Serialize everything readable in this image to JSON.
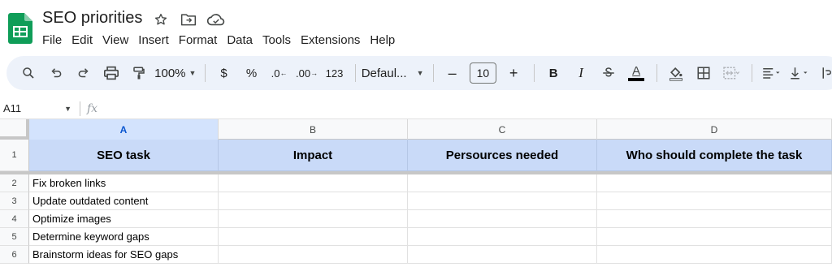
{
  "document": {
    "title": "SEO priorities"
  },
  "icons": {
    "logo": "google-sheets-logo",
    "star": "star-icon",
    "move": "move-to-folder-icon",
    "cloud": "cloud-saved-icon"
  },
  "menu": [
    "File",
    "Edit",
    "View",
    "Insert",
    "Format",
    "Data",
    "Tools",
    "Extensions",
    "Help"
  ],
  "toolbar": {
    "zoom": "100%",
    "currency": "$",
    "percent": "%",
    "decrease_decimal": ".0",
    "increase_decimal": ".00",
    "number_format": "123",
    "font_family": "Defaul...",
    "font_size": "10",
    "minus": "–",
    "plus": "+",
    "bold": "B",
    "italic": "I",
    "text_color": "A"
  },
  "formula_bar": {
    "name_box": "A11",
    "fx": "fx"
  },
  "columns": [
    "A",
    "B",
    "C",
    "D"
  ],
  "rows": [
    "1",
    "2",
    "3",
    "4",
    "5",
    "6"
  ],
  "table": {
    "headers": [
      "SEO task",
      "Impact",
      "Persources needed",
      "Who should complete the task"
    ],
    "tasks": [
      "Fix broken links",
      "Update outdated content",
      "Optimize images",
      "Determine keyword gaps",
      "Brainstorm ideas for SEO gaps"
    ]
  },
  "colors": {
    "header_fill": "#c9daf8",
    "selected_column": "#d3e3fd",
    "toolbar_bg": "#edf2fa",
    "sheets_green": "#0f9d58"
  }
}
